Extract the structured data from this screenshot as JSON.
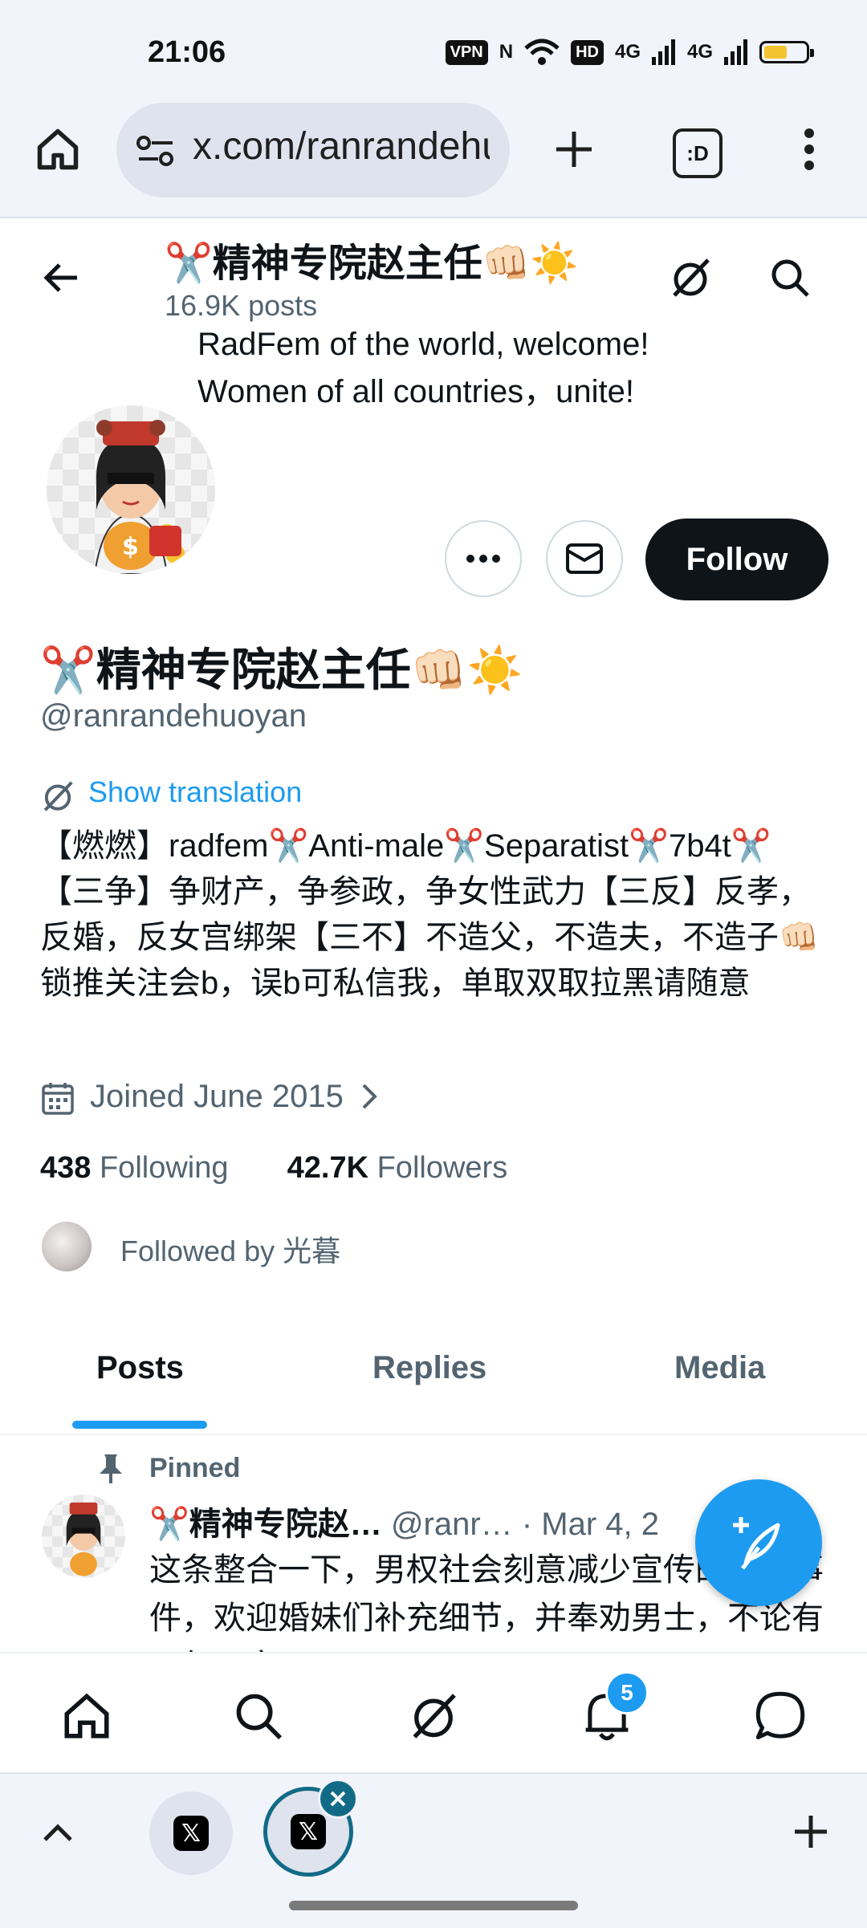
{
  "status_bar": {
    "time": "21:06",
    "vpn": "VPN",
    "nfc": "N",
    "hd": "HD",
    "sig1": "4G",
    "sig2": "4G",
    "battery_level": 0.55,
    "battery_color": "#f4c430"
  },
  "browser": {
    "url": "x.com/ranrandehuoyan",
    "home_icon": "home-icon",
    "site_info_icon": "tune-icon",
    "new_tab_icon": "plus-icon",
    "tab_switcher_label": ":D",
    "menu_icon": "more-vertical-icon"
  },
  "header": {
    "name": "✂️精神专院赵主任👊🏻☀️",
    "post_count": "16.9K posts",
    "bio_banner_line1": "RadFem of the world, welcome!",
    "bio_banner_line2": "Women of all countries，unite!"
  },
  "profile": {
    "name": "✂️精神专院赵主任👊🏻☀️",
    "handle": "@ranrandehuoyan",
    "translate_label": "Show translation",
    "bio": "【燃燃】radfem✂️Anti-male✂️Separatist✂️7b4t✂️【三争】争财产，争参政，争女性武力【三反】反孝，反婚，反女宫绑架【三不】不造父，不造夫，不造子👊🏻锁推关注会b，误b可私信我，单取双取拉黑请随意",
    "joined": "Joined June 2015",
    "following_count": "438",
    "following_label": "Following",
    "followers_count": "42.7K",
    "followers_label": "Followers",
    "followed_by": "Followed by 光暮",
    "follow_label": "Follow"
  },
  "tabs": [
    {
      "label": "Posts",
      "active": true
    },
    {
      "label": "Replies",
      "active": false
    },
    {
      "label": "Media",
      "active": false
    }
  ],
  "post": {
    "pinned_label": "Pinned",
    "author_name": "✂️精神专院赵…",
    "author_handle": "@ranr…",
    "date": "· Mar 4, 2",
    "text": "这条整合一下，男权社会刻意减少宣传的女人事件，欢迎婚妹们补充细节，并奉劝男士，不论有一但不产"
  },
  "bottom_nav": {
    "items": [
      "home-icon",
      "search-icon",
      "grok-icon",
      "bell-icon",
      "message-icon"
    ],
    "notification_count": "5"
  },
  "tab_strip": {
    "tab1_label": "𝕏",
    "tab2_label": "𝕏"
  },
  "colors": {
    "accent": "#1d9bf0",
    "text_primary": "#0f1419",
    "text_secondary": "#536471",
    "chrome_bg": "#f1f4fb"
  }
}
